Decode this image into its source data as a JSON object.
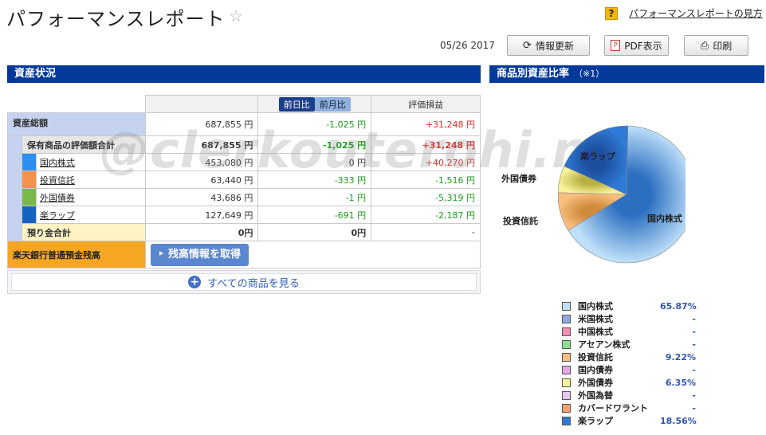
{
  "header": {
    "title": "パフォーマンスレポート",
    "help_link": "パフォーマンスレポートの見方",
    "date": "05/26 2017",
    "refresh_label": "情報更新",
    "pdf_label": "PDF表示",
    "print_label": "印刷"
  },
  "left_section": {
    "title": "資産状況"
  },
  "right_section": {
    "title": "商品別資産比率",
    "note": "（※1）"
  },
  "table": {
    "tab_day": "前日比",
    "tab_month": "前月比",
    "col_pnl": "評価損益",
    "total": {
      "label": "資産総額",
      "value": "687,855 円",
      "change": "-1,025 円",
      "pnl": "+31,248 円"
    },
    "holdings": {
      "label": "保有商品の評価額合計",
      "value": "687,855 円",
      "change": "-1,025 円",
      "pnl": "+31,248 円"
    },
    "products": [
      {
        "name": "国内株式",
        "value": "453,080 円",
        "change": "0 円",
        "pnl": "+40,270 円",
        "color": "#2b8ef0"
      },
      {
        "name": "投資信託",
        "value": "63,440 円",
        "change": "-333 円",
        "pnl": "-1,516 円",
        "color": "#f5914a"
      },
      {
        "name": "外国債券",
        "value": "43,686 円",
        "change": "-1 円",
        "pnl": "-5,319 円",
        "color": "#79b84a"
      },
      {
        "name": "楽ラップ",
        "value": "127,649 円",
        "change": "-691 円",
        "pnl": "-2,187 円",
        "color": "#1565c0"
      }
    ],
    "deposit": {
      "label": "預り金合計",
      "value": "0円",
      "change": "0円",
      "pnl": "-"
    },
    "rakuten_bank": {
      "label": "楽天銀行普通預金残高",
      "button": "残高情報を取得"
    }
  },
  "see_all": "すべての商品を見る",
  "watermark": "@clerkouterohi.net",
  "chart_data": {
    "type": "pie",
    "labels": [
      "国内株式",
      "米国株式",
      "中国株式",
      "アセアン株式",
      "投資信託",
      "国内債券",
      "外国債券",
      "外国為替",
      "カバードワラント",
      "楽ラップ"
    ],
    "percent_text": [
      "65.87%",
      "-",
      "-",
      "-",
      "9.22%",
      "-",
      "6.35%",
      "-",
      "-",
      "18.56%"
    ],
    "values": [
      65.87,
      0,
      0,
      0,
      9.22,
      0,
      6.35,
      0,
      0,
      18.56
    ],
    "colors": [
      "#bfe0fa",
      "#8ea9e0",
      "#f08fb4",
      "#8ee08e",
      "#f8bf80",
      "#e6a3e6",
      "#f7f29a",
      "#e9c8f0",
      "#f4a070",
      "#2f7ad6"
    ],
    "slice_labels": [
      "国内株式",
      "投資信託",
      "外国債券",
      "楽ラップ"
    ]
  }
}
